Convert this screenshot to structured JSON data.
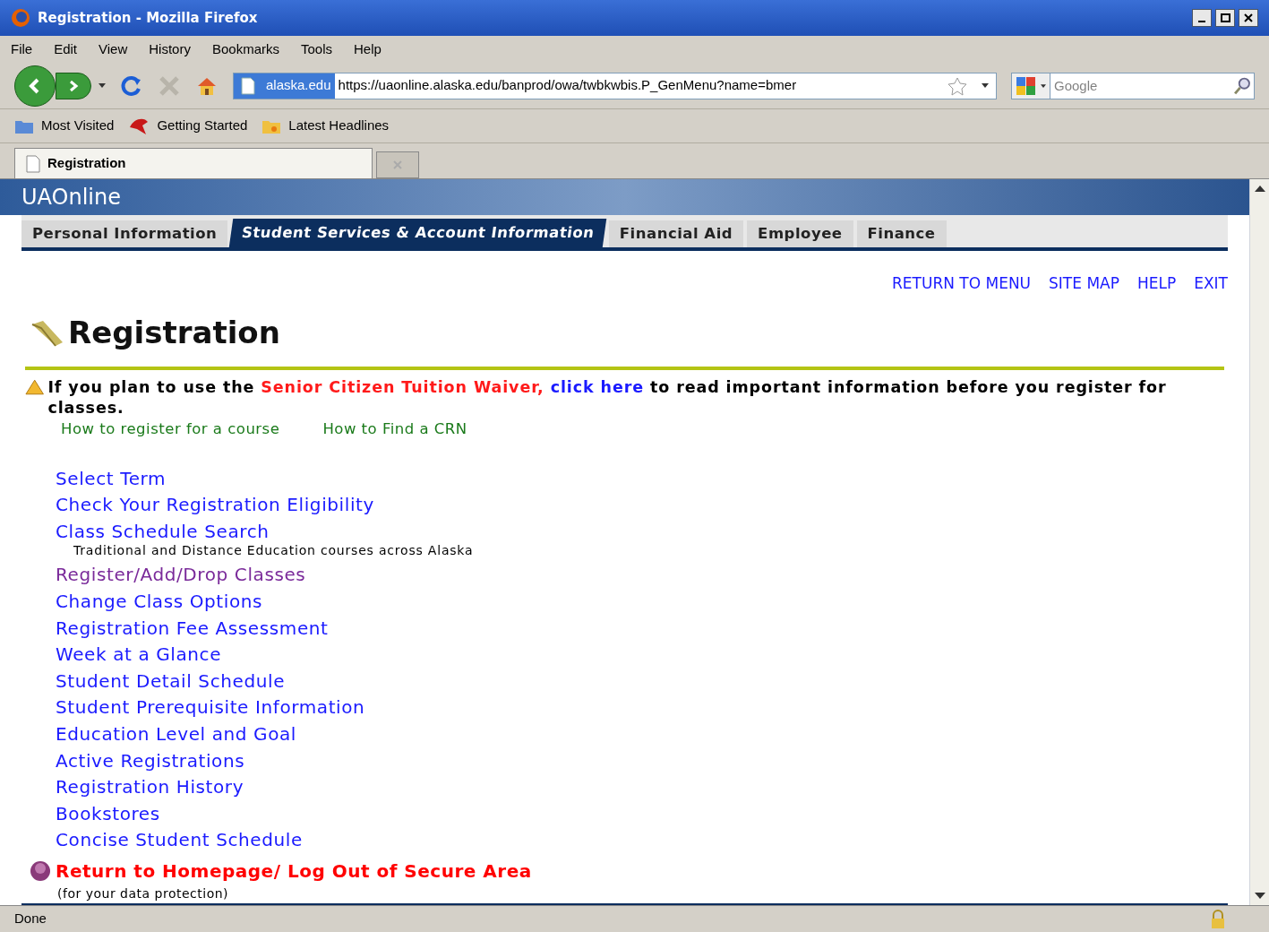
{
  "window": {
    "title": "Registration - Mozilla Firefox"
  },
  "menu_bar": [
    "File",
    "Edit",
    "View",
    "History",
    "Bookmarks",
    "Tools",
    "Help"
  ],
  "address_bar": {
    "site": "alaska.edu",
    "url": "https://uaonline.alaska.edu/banprod/owa/twbkwbis.P_GenMenu?name=bmer"
  },
  "search": {
    "placeholder": "Google"
  },
  "bookmarks": [
    "Most Visited",
    "Getting Started",
    "Latest Headlines"
  ],
  "browser_tabs": [
    {
      "label": "Registration",
      "selected": true
    }
  ],
  "site": {
    "banner": "UAOnline",
    "tabs": [
      {
        "label": "Personal Information",
        "selected": false
      },
      {
        "label": "Student Services & Account Information",
        "selected": true
      },
      {
        "label": "Financial Aid",
        "selected": false
      },
      {
        "label": "Employee",
        "selected": false
      },
      {
        "label": "Finance",
        "selected": false
      }
    ],
    "top_links": [
      "RETURN TO MENU",
      "SITE MAP",
      "HELP",
      "EXIT"
    ],
    "heading": "Registration",
    "notice": {
      "prefix": "If you plan to use the ",
      "highlight": "Senior Citizen Tuition Waiver,",
      "link": "click here",
      "suffix": " to read important information before you register for classes."
    },
    "help_links": [
      "How to register for a course",
      "How to Find a CRN"
    ],
    "menu_items": [
      {
        "label": "Select Term",
        "visited": false
      },
      {
        "label": "Check Your Registration Eligibility",
        "visited": false
      },
      {
        "label": "Class Schedule Search",
        "visited": false,
        "description": "Traditional and Distance Education courses across Alaska"
      },
      {
        "label": "Register/Add/Drop Classes",
        "visited": true
      },
      {
        "label": "Change Class Options",
        "visited": false
      },
      {
        "label": "Registration Fee Assessment",
        "visited": false
      },
      {
        "label": "Week at a Glance",
        "visited": false
      },
      {
        "label": "Student Detail Schedule",
        "visited": false
      },
      {
        "label": "Student Prerequisite Information",
        "visited": false
      },
      {
        "label": "Education Level and Goal",
        "visited": false
      },
      {
        "label": "Active Registrations",
        "visited": false
      },
      {
        "label": "Registration History",
        "visited": false
      },
      {
        "label": "Bookstores",
        "visited": false
      },
      {
        "label": "Concise Student Schedule",
        "visited": false
      }
    ],
    "logout": {
      "label": "Return to Homepage/ Log Out of Secure Area",
      "note": "(for your data protection)"
    }
  },
  "status_bar": "Done"
}
